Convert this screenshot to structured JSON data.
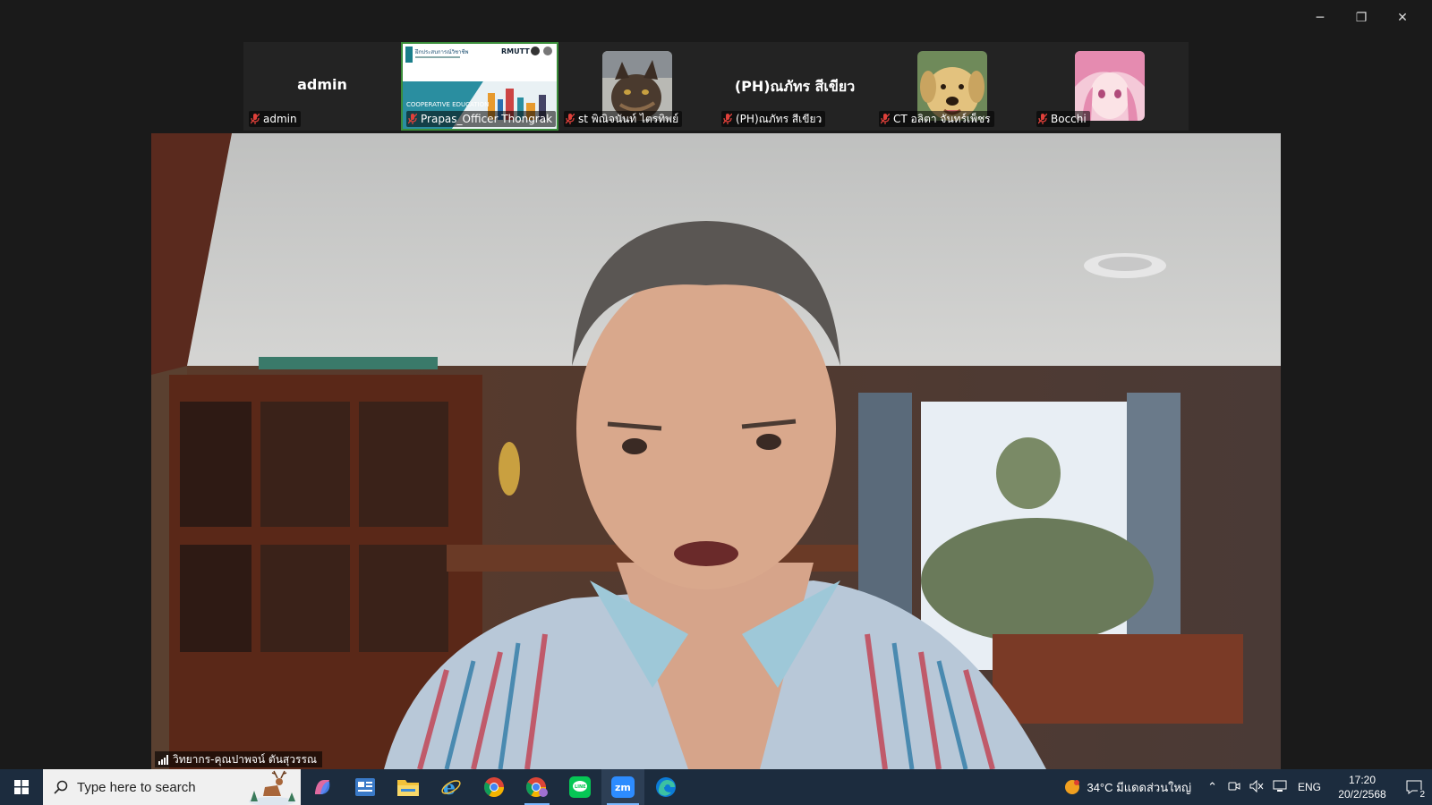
{
  "window_controls": {
    "minimize": "─",
    "restore": "❐",
    "close": "✕"
  },
  "participants": [
    {
      "name_big": "admin",
      "label": "admin",
      "type": "name"
    },
    {
      "label": "Prapas_Officer Thongrak",
      "type": "slide",
      "slide_title": "ฝึกประสบการณ์วิชาชีพ",
      "slide_logo": "RMUTT",
      "slide_text": "COOPERATIVE EDUCATION"
    },
    {
      "label": "st พิณิจนันท์ ไตรทิพย์",
      "type": "avatar",
      "avatar": "cat"
    },
    {
      "name_big": "(PH)ณภัทร สีเขียว",
      "label": "(PH)ณภัทร สีเขียว",
      "type": "name"
    },
    {
      "label": "CT อลิตา จันทร์เพ็ชร",
      "type": "avatar",
      "avatar": "dog"
    },
    {
      "label": "Bocchi",
      "type": "avatar",
      "avatar": "anime"
    }
  ],
  "main_speaker": {
    "label": "วิทยากร-คุณปาพจน์ ตันสุวรรณ"
  },
  "taskbar": {
    "search_placeholder": "Type here to search",
    "apps": [
      "copilot-icon",
      "widgets-icon",
      "file-explorer-icon",
      "internet-explorer-icon",
      "chrome-icon",
      "chrome-profile-icon",
      "line-icon",
      "zoom-icon",
      "edge-icon"
    ],
    "weather": "34°C  มีแดดส่วนใหญ่",
    "lang": "ENG",
    "time": "17:20",
    "date": "20/2/2568",
    "notifications": "2"
  },
  "colors": {
    "taskbar": "#1c2c3e",
    "accent": "#7ab8ff",
    "window": "#1a1a1a"
  }
}
